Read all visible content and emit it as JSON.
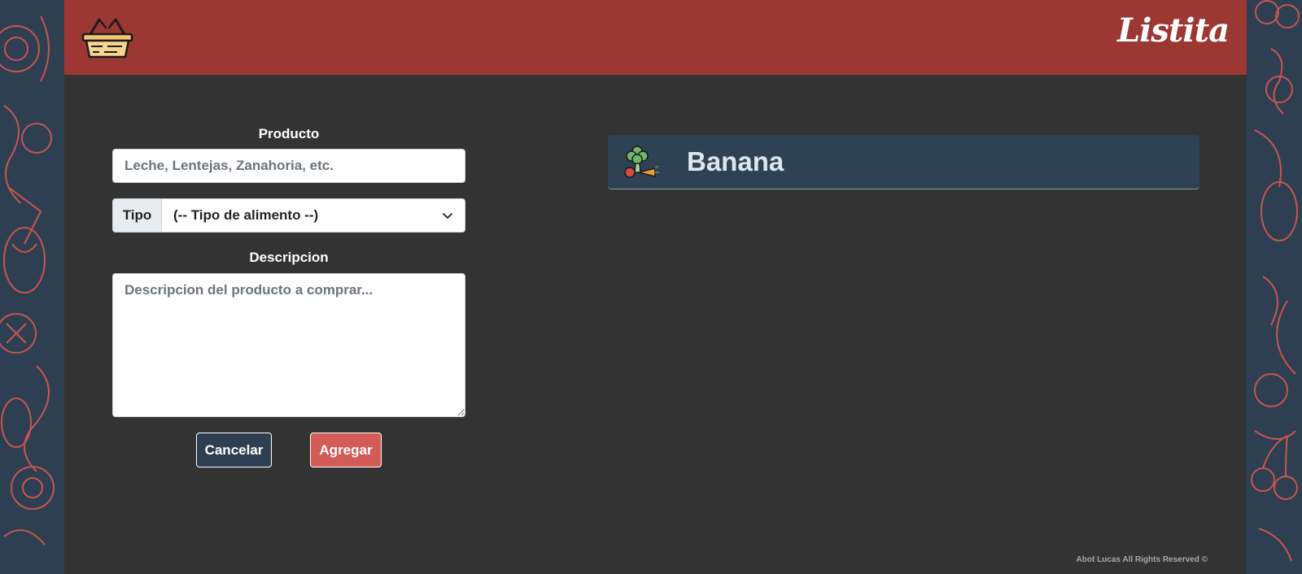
{
  "header": {
    "logo_icon": "basket-icon",
    "brand": "Listita"
  },
  "form": {
    "product_label": "Producto",
    "product_placeholder": "Leche, Lentejas, Zanahoria, etc.",
    "type_label": "Tipo",
    "type_selected": "(-- Tipo de alimento --)",
    "description_label": "Descripcion",
    "description_placeholder": "Descripcion del producto a comprar...",
    "cancel_label": "Cancelar",
    "add_label": "Agregar"
  },
  "list": {
    "items": [
      {
        "name": "Banana",
        "icon": "vegetables-icon"
      }
    ]
  },
  "footer": {
    "text": "Abot Lucas All Rights Reserved ©"
  },
  "colors": {
    "header": "#9c3733",
    "app_background": "#333333",
    "page_background": "#2e3f52",
    "pattern_stroke": "#c5564f",
    "list_item": "#2e4254",
    "cancel_button": "#2e3f52",
    "add_button": "#d45b57"
  }
}
